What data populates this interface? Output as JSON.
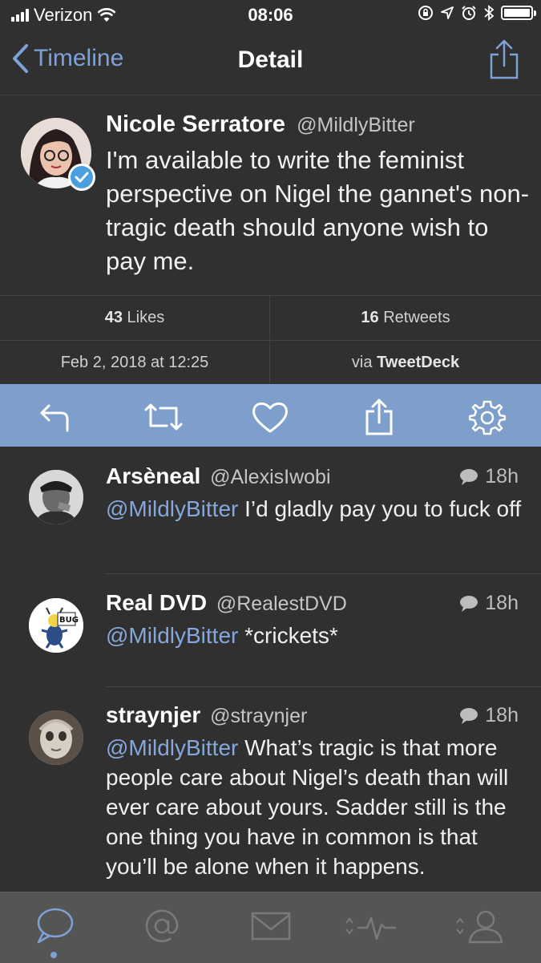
{
  "status": {
    "carrier": "Verizon",
    "time": "08:06",
    "battery_level": 1.0
  },
  "nav": {
    "back_label": "Timeline",
    "title": "Detail"
  },
  "tweet": {
    "name": "Nicole Serratore",
    "handle": "@MildlyBitter",
    "text": "I'm available to write the feminist perspective on Nigel the gannet's non-tragic death should anyone wish to pay me."
  },
  "stats": {
    "likes_count": "43",
    "likes_label": "Likes",
    "retweets_count": "16",
    "retweets_label": "Retweets",
    "date": "Feb 2, 2018 at 12:25",
    "via_prefix": "via",
    "via_app": "TweetDeck"
  },
  "replies": [
    {
      "name": "Arsèneal",
      "handle": "@AlexisIwobi",
      "time": "18h",
      "mention": "@MildlyBitter",
      "text": " I’d gladly pay you to fuck off"
    },
    {
      "name": "Real DVD",
      "handle": "@RealestDVD",
      "time": "18h",
      "mention": "@MildlyBitter",
      "text": " *crickets*"
    },
    {
      "name": "straynjer",
      "handle": "@straynjer",
      "time": "18h",
      "mention": "@MildlyBitter",
      "text": " What’s tragic is that more people care about Nigel’s death than will ever care about yours. Sadder still is the one thing you have in common is that you’ll be alone when it happens."
    }
  ],
  "avatar_badge_text": "BUG",
  "colors": {
    "accent": "#7ea1d6",
    "background": "#303030",
    "action_bar": "#7e9fcb",
    "tab_bar": "#555555"
  },
  "icons": {
    "action_bar": [
      "reply-icon",
      "retweet-icon",
      "heart-icon",
      "share-icon",
      "settings-gear-icon"
    ],
    "tab_bar": [
      "timeline-chat-icon",
      "mentions-at-icon",
      "messages-envelope-icon",
      "activity-icon",
      "profile-icon"
    ]
  }
}
